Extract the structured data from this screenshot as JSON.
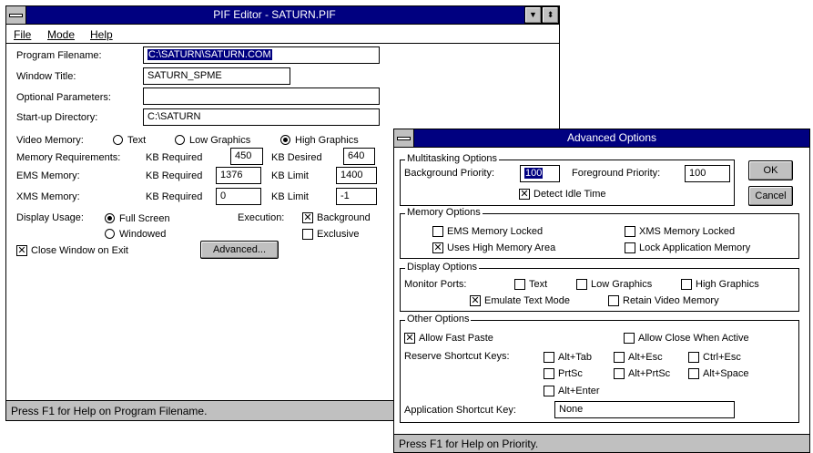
{
  "pif": {
    "title": "PIF Editor - SATURN.PIF",
    "menu": {
      "file": "File",
      "mode": "Mode",
      "help": "Help"
    },
    "labels": {
      "program_filename": "Program Filename:",
      "window_title": "Window Title:",
      "optional_parameters": "Optional Parameters:",
      "startup_directory": "Start-up Directory:",
      "video_memory": "Video Memory:",
      "memory_requirements": "Memory Requirements:",
      "ems_memory": "EMS Memory:",
      "xms_memory": "XMS Memory:",
      "display_usage": "Display Usage:",
      "execution": "Execution:",
      "kb_required": "KB Required",
      "kb_desired": "KB Desired",
      "kb_limit": "KB Limit"
    },
    "values": {
      "program_filename": "C:\\SATURN\\SATURN.COM",
      "window_title": "SATURN_SPME",
      "optional_parameters": "",
      "startup_directory": "C:\\SATURN",
      "mem_required": "450",
      "mem_desired": "640",
      "ems_required": "1376",
      "ems_limit": "1400",
      "xms_required": "0",
      "xms_limit": "-1"
    },
    "video": {
      "text": "Text",
      "low": "Low Graphics",
      "high": "High Graphics",
      "selected": "high"
    },
    "display": {
      "full": "Full Screen",
      "windowed": "Windowed",
      "selected": "full"
    },
    "execution": {
      "background": "Background",
      "background_checked": true,
      "exclusive": "Exclusive",
      "exclusive_checked": false
    },
    "close_on_exit": {
      "label": "Close Window on Exit",
      "checked": true
    },
    "advanced_button": "Advanced...",
    "status": "Press F1 for Help on Program Filename."
  },
  "adv": {
    "title": "Advanced Options",
    "ok": "OK",
    "cancel": "Cancel",
    "multitasking": {
      "title": "Multitasking Options",
      "background_priority_label": "Background Priority:",
      "background_priority": "100",
      "foreground_priority_label": "Foreground Priority:",
      "foreground_priority": "100",
      "detect_idle": "Detect Idle Time"
    },
    "memory": {
      "title": "Memory Options",
      "ems_locked": "EMS Memory Locked",
      "xms_locked": "XMS Memory Locked",
      "uses_hma": "Uses High Memory Area",
      "lock_app": "Lock Application Memory"
    },
    "display": {
      "title": "Display Options",
      "monitor_ports": "Monitor Ports:",
      "text": "Text",
      "low": "Low Graphics",
      "high": "High Graphics",
      "emulate": "Emulate Text Mode",
      "retain": "Retain Video Memory"
    },
    "other": {
      "title": "Other Options",
      "fast_paste": "Allow Fast Paste",
      "allow_close": "Allow Close When Active",
      "reserve_keys": "Reserve Shortcut Keys:",
      "alt_tab": "Alt+Tab",
      "alt_esc": "Alt+Esc",
      "ctrl_esc": "Ctrl+Esc",
      "prtsc": "PrtSc",
      "alt_prtsc": "Alt+PrtSc",
      "alt_space": "Alt+Space",
      "alt_enter": "Alt+Enter",
      "app_shortcut_label": "Application Shortcut Key:",
      "app_shortcut": "None"
    },
    "status": "Press F1 for Help on Priority."
  },
  "colors": {
    "titlebar": "#000080",
    "chrome": "#c0c0c0",
    "highlight": "#000080"
  }
}
